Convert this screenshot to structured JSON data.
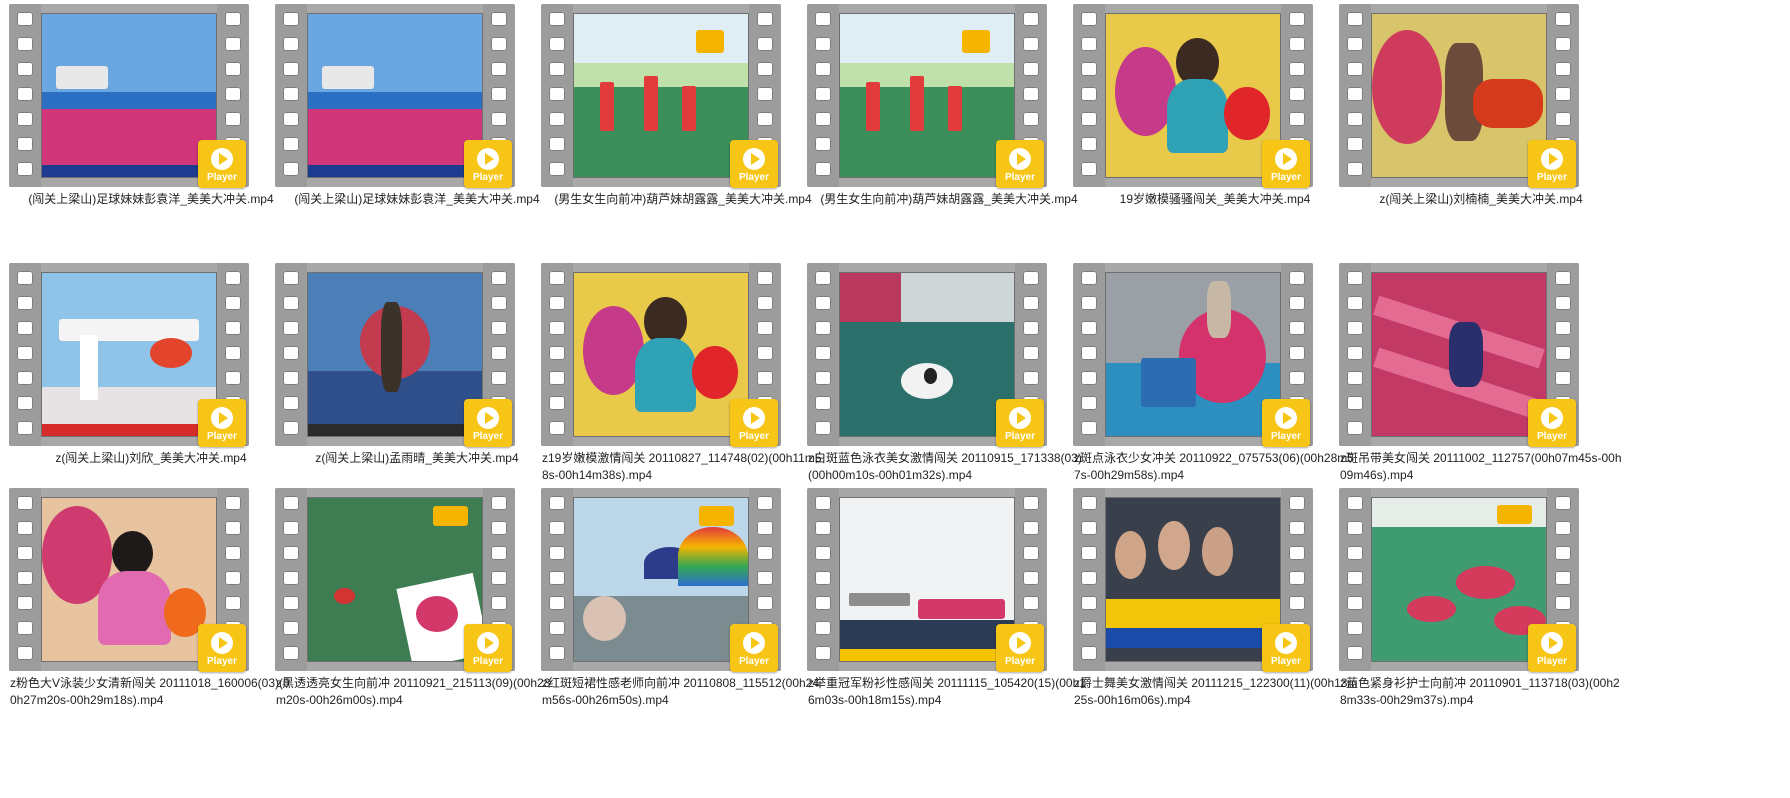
{
  "files": [
    {
      "name": "(闯关上梁山)足球妹妹彭袁洋_美美大冲关.mp4",
      "align": "center",
      "scene": "sky-pink-bridge"
    },
    {
      "name": "(闯关上梁山)足球妹妹彭袁洋_美美大冲关.mp4",
      "align": "center",
      "scene": "sky-pink-bridge"
    },
    {
      "name": "(男生女生向前冲)葫芦妹胡露露_美美大冲关.mp4",
      "align": "center",
      "scene": "pool-posts"
    },
    {
      "name": "(男生女生向前冲)葫芦妹胡露露_美美大冲关.mp4",
      "align": "center",
      "scene": "pool-posts"
    },
    {
      "name": "19岁嫩模骚骚闯关_美美大冲关.mp4",
      "align": "center",
      "scene": "girl-yellow-wall"
    },
    {
      "name": "z(闯关上梁山)刘楠楠_美美大冲关.mp4",
      "align": "center",
      "scene": "girl-red-roller"
    },
    {
      "name": "z(闯关上梁山)刘欣_美美大冲关.mp4",
      "align": "center",
      "scene": "white-arch"
    },
    {
      "name": "z(闯关上梁山)孟雨晴_美美大冲关.mp4",
      "align": "center",
      "scene": "blue-obstacle"
    },
    {
      "name": "z19岁嫩模激情闯关 20110827_114748(02)(00h11m58s-00h14m38s).mp4",
      "align": "left",
      "scene": "girl-yellow-wall"
    },
    {
      "name": "z白斑蓝色泳衣美女激情闯关 20110915_171338(03)(00h00m10s-00h01m32s).mp4",
      "align": "left",
      "scene": "splash-water"
    },
    {
      "name": "z斑点泳衣少女冲关 20110922_075753(06)(00h28m57s-00h29m58s).mp4",
      "align": "left",
      "scene": "pink-ball"
    },
    {
      "name": "z斑吊带美女闯关 20111002_112757(00h07m45s-00h09m46s).mp4",
      "align": "left",
      "scene": "pink-slide"
    },
    {
      "name": "z粉色大V泳装少女清新闯关 20111018_160006(03)(00h27m20s-00h29m18s).mp4",
      "align": "left",
      "scene": "girl-pink-suit"
    },
    {
      "name": "z黑透透亮女生向前冲 20110921_215113(09)(00h23m20s-00h26m00s).mp4",
      "align": "left",
      "scene": "green-water-stepping"
    },
    {
      "name": "z红斑短裙性感老师向前冲 20110808_115512(00h24m56s-00h26m50s).mp4",
      "align": "left",
      "scene": "tents-rainbow"
    },
    {
      "name": "z举重冠军粉衫性感闯关 20111115_105420(15)(00h16m03s-00h18m15s).mp4",
      "align": "left",
      "scene": "white-sky-bridge"
    },
    {
      "name": "z爵士舞美女激情闯关 20111215_122300(11)(00h13m25s-00h16m06s).mp4",
      "align": "left",
      "scene": "audience-ad"
    },
    {
      "name": "z蓝色紧身衫护士向前冲 20110901_113718(03)(00h28m33s-00h29m37s).mp4",
      "align": "left",
      "scene": "green-pool-discs"
    }
  ],
  "player_label": "Player",
  "icons": {
    "play": "play-icon",
    "film": "film-strip-icon"
  },
  "colors": {
    "player_button": "#f7c515",
    "film_strip": "#9c9c9c"
  }
}
